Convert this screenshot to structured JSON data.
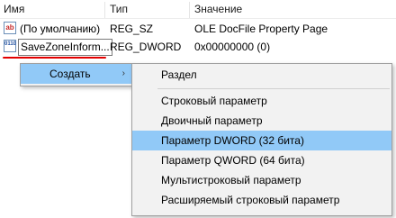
{
  "headers": {
    "name": "Имя",
    "type": "Тип",
    "value": "Значение"
  },
  "rows": [
    {
      "icon": "string-value-icon",
      "icon_text": "ab",
      "name": "(По умолчанию)",
      "type": "REG_SZ",
      "value": "OLE DocFile Property Page"
    },
    {
      "icon": "binary-value-icon",
      "icon_text": "0110",
      "name": "SaveZoneInform...",
      "type": "REG_DWORD",
      "value": "0x00000000 (0)"
    }
  ],
  "context_menu": {
    "create_label": "Создать",
    "arrow": "›"
  },
  "submenu": {
    "items": [
      "Раздел",
      "Строковый параметр",
      "Двоичный параметр",
      "Параметр DWORD (32 бита)",
      "Параметр QWORD (64 бита)",
      "Мультистроковый параметр",
      "Расширяемый строковый параметр"
    ],
    "highlighted": "Параметр DWORD (32 бита)"
  },
  "colors": {
    "highlight": "#91c9f7",
    "annotation": "#e30000",
    "menu_bg": "#f2f2f2"
  }
}
